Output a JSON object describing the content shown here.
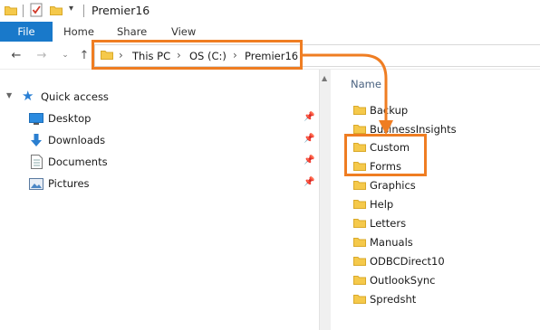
{
  "window": {
    "title": "Premier16",
    "ribbon_tabs": [
      "File",
      "Home",
      "Share",
      "View"
    ]
  },
  "address": {
    "breadcrumbs": [
      "This PC",
      "OS (C:)",
      "Premier16"
    ]
  },
  "sidebar": {
    "quick_access_label": "Quick access",
    "items": [
      {
        "label": "Desktop",
        "icon": "desktop-icon",
        "pinned": true
      },
      {
        "label": "Downloads",
        "icon": "download-arrow-icon",
        "pinned": true
      },
      {
        "label": "Documents",
        "icon": "document-icon",
        "pinned": true
      },
      {
        "label": "Pictures",
        "icon": "picture-icon",
        "pinned": true
      }
    ]
  },
  "file_list": {
    "column_header": "Name",
    "items": [
      {
        "name": "Backup"
      },
      {
        "name": "BusinessInsights"
      },
      {
        "name": "Custom",
        "highlighted": true
      },
      {
        "name": "Forms",
        "highlighted": true
      },
      {
        "name": "Graphics"
      },
      {
        "name": "Help"
      },
      {
        "name": "Letters"
      },
      {
        "name": "Manuals"
      },
      {
        "name": "ODBCDirect10"
      },
      {
        "name": "OutlookSync"
      },
      {
        "name": "Spredsht"
      }
    ]
  },
  "colors": {
    "accent": "#1979ca",
    "annotation": "#ef7d22",
    "folder": "#f5c94b"
  }
}
